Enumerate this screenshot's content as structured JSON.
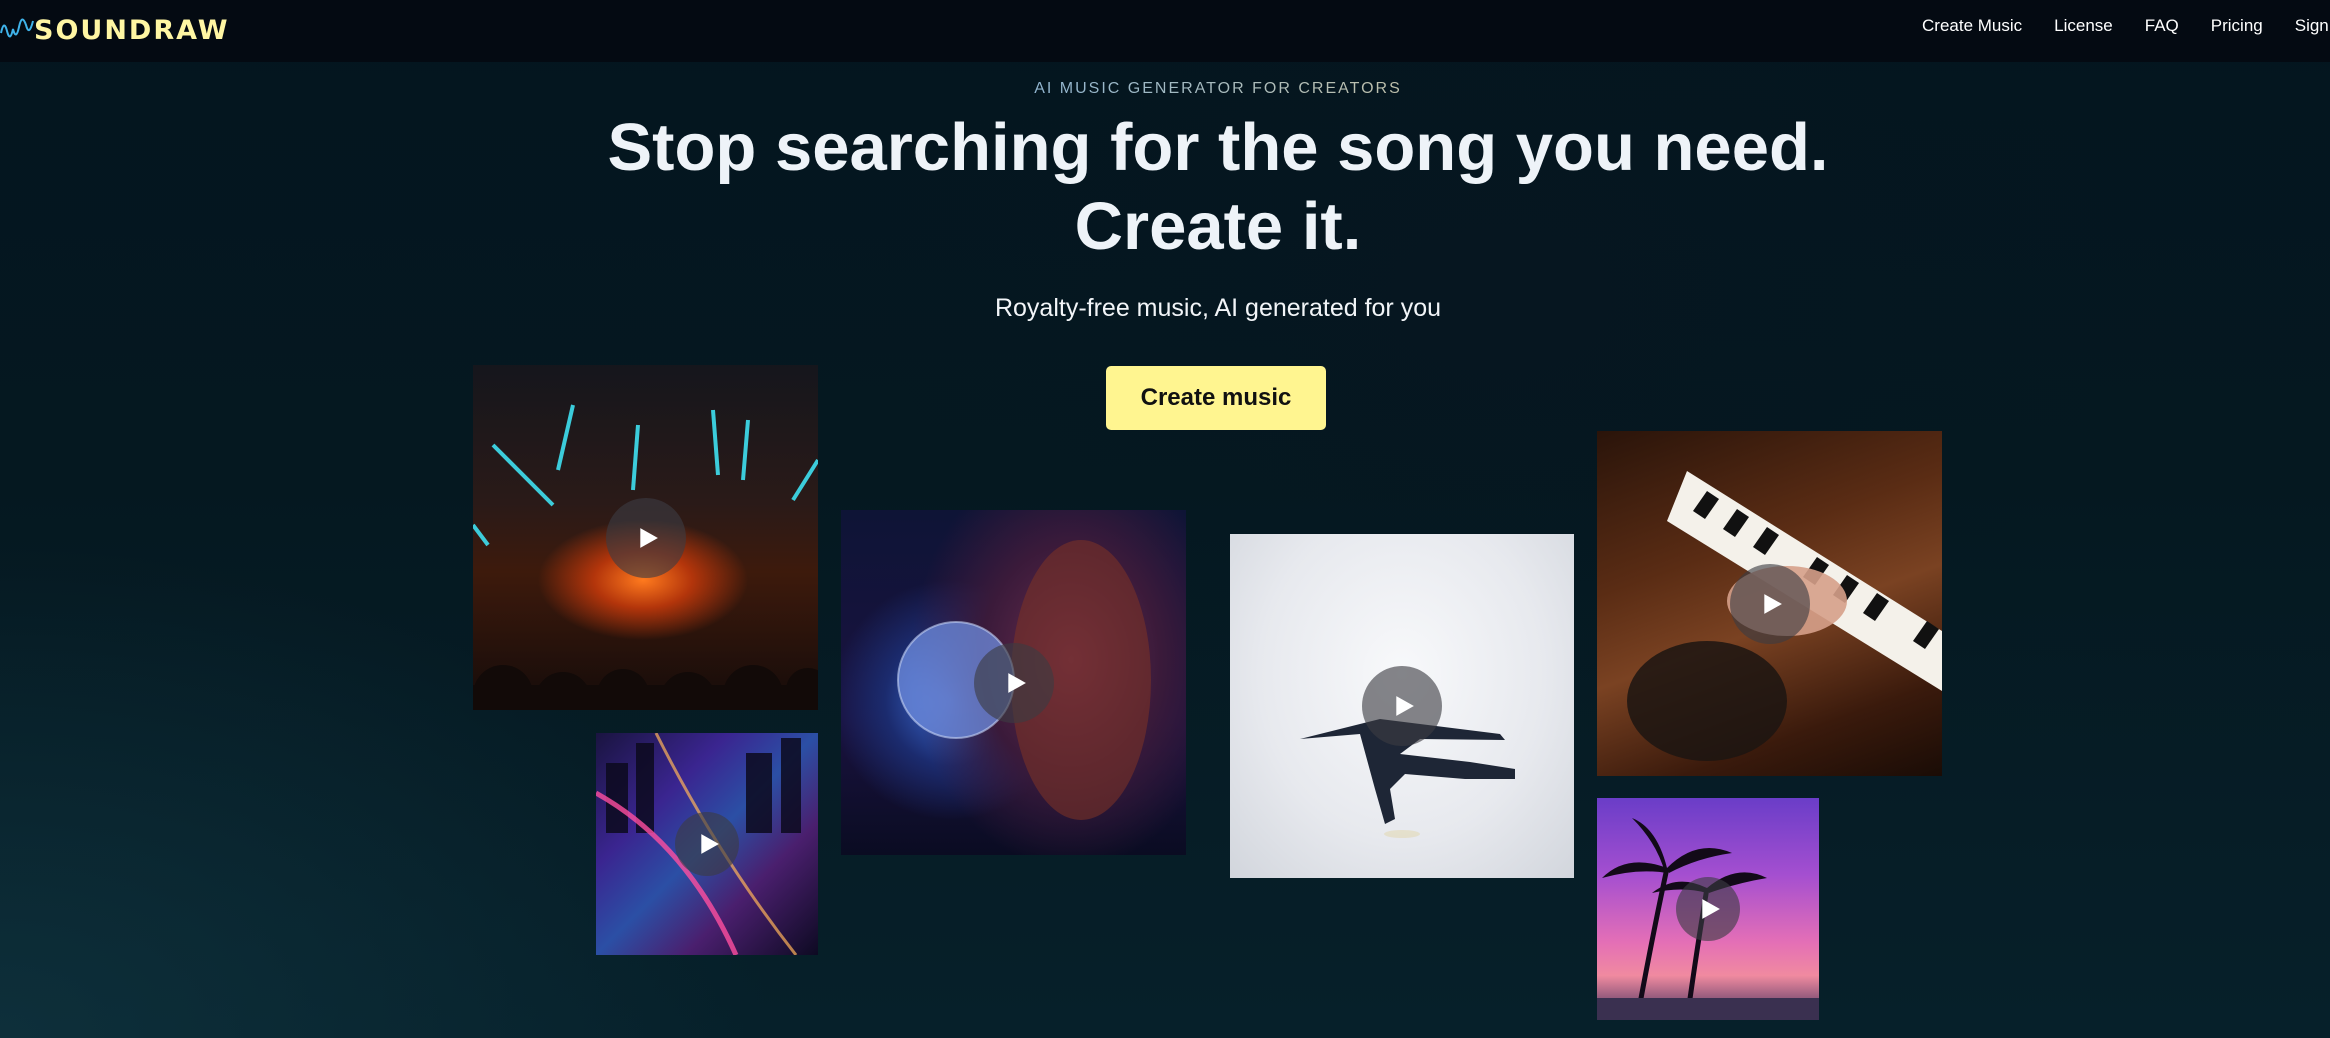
{
  "brand": {
    "name": "SOUNDRAW",
    "color": "#fff6a3"
  },
  "nav": {
    "items": [
      "Create Music",
      "License",
      "FAQ",
      "Pricing",
      "Sign i"
    ]
  },
  "hero": {
    "eyebrow": "AI MUSIC GENERATOR FOR CREATORS",
    "headline_line1": "Stop searching for the song you need.",
    "headline_line2": "Create it.",
    "subheadline": "Royalty-free music, AI generated for you",
    "cta_label": "Create music",
    "cta_color": "#fff590"
  },
  "tiles": [
    {
      "name": "concert-lights",
      "icon": "play-icon"
    },
    {
      "name": "city-night",
      "icon": "play-icon"
    },
    {
      "name": "disco-ball-woman",
      "icon": "play-icon"
    },
    {
      "name": "dancer",
      "icon": "play-icon"
    },
    {
      "name": "piano-hands",
      "icon": "play-icon"
    },
    {
      "name": "palm-sunset",
      "icon": "play-icon"
    }
  ],
  "colors": {
    "background": "#03121b",
    "navbar": "#040a12",
    "text": "#eef3f8"
  }
}
